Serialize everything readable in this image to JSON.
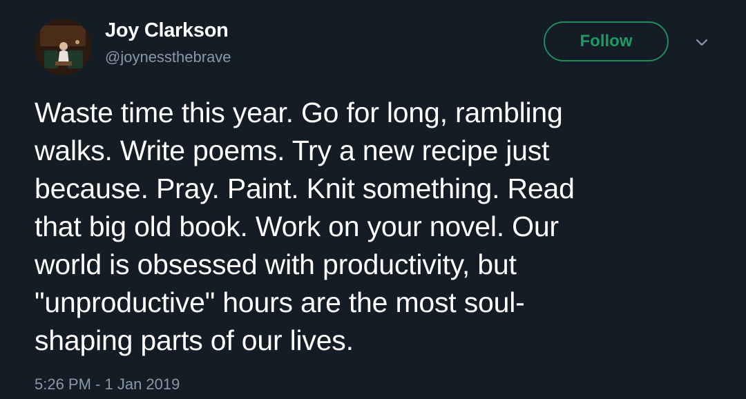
{
  "author": {
    "display_name": "Joy Clarkson",
    "handle": "@joynessthebrave"
  },
  "actions": {
    "follow_label": "Follow",
    "more_icon": "chevron-down-icon"
  },
  "tweet": {
    "lines": [
      "Waste time this year. Go for long, rambling",
      "walks. Write poems. Try a new recipe just",
      "because. Pray. Paint. Knit something. Read",
      "that big old book. Work on your novel. Our",
      "world is obsessed with productivity, but",
      "\"unproductive\" hours are the most soul-",
      "shaping parts of our lives."
    ],
    "timestamp": "5:26 PM - 1 Jan 2019"
  },
  "colors": {
    "background": "#141d26",
    "text": "#ffffff",
    "secondary_text": "#8899a6",
    "follow_accent": "#1f9a62"
  }
}
